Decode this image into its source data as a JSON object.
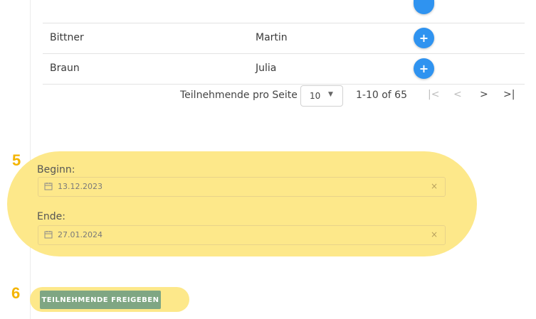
{
  "table": {
    "rows": [
      {
        "last_name": "",
        "first_name": ""
      },
      {
        "last_name": "Bittner",
        "first_name": "Martin"
      },
      {
        "last_name": "Braun",
        "first_name": "Julia"
      }
    ],
    "add_label": "+"
  },
  "pagination": {
    "per_page_label": "Teilnehmende pro Seite",
    "per_page_value": "10",
    "range": "1-10 of 65",
    "first_icon": "|<",
    "prev_icon": "<",
    "next_icon": ">",
    "last_icon": ">|"
  },
  "annotations": {
    "step5": "5",
    "step6": "6",
    "highlight_color": "#fde88a"
  },
  "dates": {
    "begin_label": "Beginn:",
    "begin_value": "13.12.2023",
    "end_label": "Ende:",
    "end_value": "27.01.2024",
    "clear_icon": "×"
  },
  "release_button": {
    "label": "TEILNEHMENDE FREIGEBEN",
    "color": "#7fa683"
  },
  "colors": {
    "add_button": "#2f93f0",
    "number_marker": "#f4b400"
  }
}
